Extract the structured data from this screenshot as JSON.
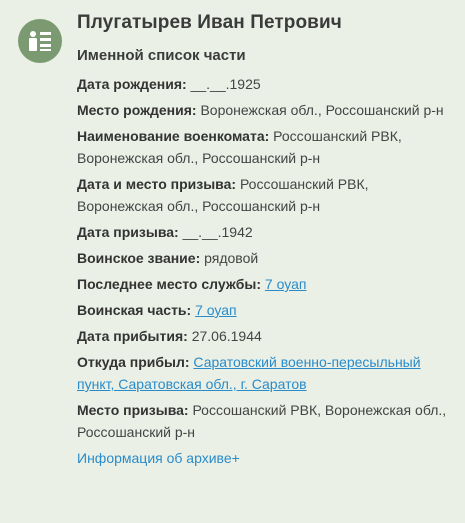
{
  "person": {
    "name": "Плугатырев Иван Петрович",
    "source_title": "Именной список части"
  },
  "fields": {
    "birth_date": {
      "label": "Дата рождения:",
      "value": "__.__.1925"
    },
    "birth_place": {
      "label": "Место рождения:",
      "value": "Воронежская обл., Россошанский р-н"
    },
    "commissariat": {
      "label": "Наименование военкомата:",
      "value": "Россошанский РВК, Воронежская обл., Россошанский р-н"
    },
    "draft_date_place": {
      "label": "Дата и место призыва:",
      "value": "Россошанский РВК, Воронежская обл., Россошанский р-н"
    },
    "draft_date": {
      "label": "Дата призыва:",
      "value": "__.__.1942"
    },
    "rank": {
      "label": "Воинское звание:",
      "value": "рядовой"
    },
    "last_service": {
      "label": "Последнее место службы:",
      "value": "7 оуап"
    },
    "unit": {
      "label": "Воинская часть:",
      "value": "7 оуап"
    },
    "arrival_date": {
      "label": "Дата прибытия:",
      "value": "27.06.1944"
    },
    "arrived_from": {
      "label": "Откуда прибыл:",
      "value": "Саратовский военно-пересыльный пункт, Саратовская обл., г. Саратов"
    },
    "draft_place": {
      "label": "Место призыва:",
      "value": "Россошанский РВК, Воронежская обл., Россошанский р-н"
    }
  },
  "archive_link": "Информация об архиве+",
  "icon": "document-list-icon",
  "colors": {
    "background": "#eaf0e6",
    "avatar": "#7b9a72",
    "link": "#2a8bc9",
    "text": "#3b3b3b"
  }
}
